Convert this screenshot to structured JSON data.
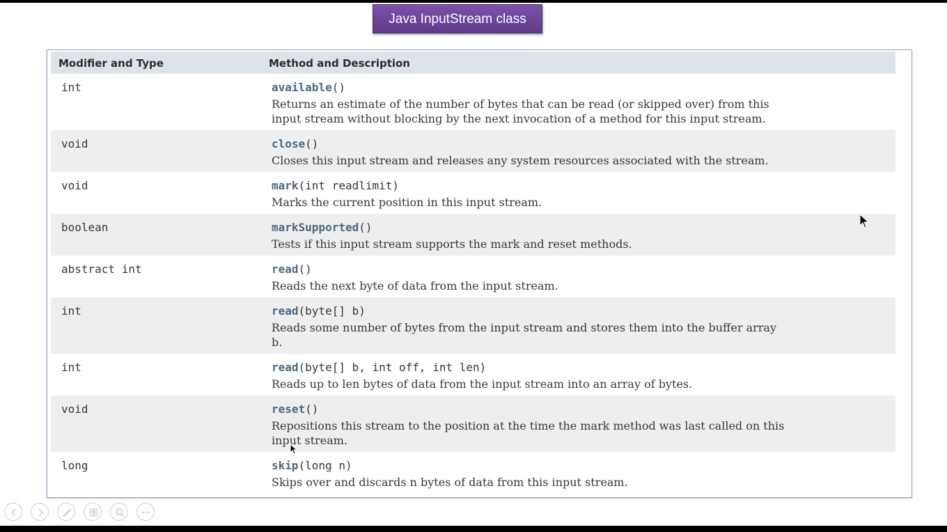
{
  "slide": {
    "title": "Java InputStream class"
  },
  "table": {
    "headers": [
      "Modifier and Type",
      "Method and Description"
    ],
    "rows": [
      {
        "type": "int",
        "name": "available",
        "params": "()",
        "desc": [
          "Returns an estimate of the number of bytes that can be read (or skipped over) from this",
          "input stream without blocking by the next invocation of a method for this input stream."
        ]
      },
      {
        "type": "void",
        "name": "close",
        "params": "()",
        "desc": [
          "Closes this input stream and releases any system resources associated with the stream."
        ]
      },
      {
        "type": "void",
        "name": "mark",
        "params": "(int readlimit)",
        "desc": [
          "Marks the current position in this input stream."
        ]
      },
      {
        "type": "boolean",
        "name": "markSupported",
        "params": "()",
        "desc": [
          "Tests if this input stream supports the mark and reset methods."
        ]
      },
      {
        "type": "abstract int",
        "name": "read",
        "params": "()",
        "desc": [
          "Reads the next byte of data from the input stream."
        ]
      },
      {
        "type": "int",
        "name": "read",
        "params": "(byte[] b)",
        "desc": [
          "Reads some number of bytes from the input stream and stores them into the buffer array",
          "b."
        ]
      },
      {
        "type": "int",
        "name": "read",
        "params": "(byte[] b, int off, int len)",
        "desc": [
          "Reads up to len bytes of data from the input stream into an array of bytes."
        ]
      },
      {
        "type": "void",
        "name": "reset",
        "params": "()",
        "desc": [
          "Repositions this stream to the position at the time the mark method was last called on this",
          "input stream."
        ]
      },
      {
        "type": "long",
        "name": "skip",
        "params": "(long n)",
        "desc": [
          "Skips over and discards n bytes of data from this input stream."
        ]
      }
    ]
  },
  "toolbar": {
    "icons": [
      "previous-icon",
      "next-icon",
      "pen-icon",
      "slides-icon",
      "zoom-icon",
      "more-icon"
    ]
  },
  "colors": {
    "title_bg": "#6a4597",
    "header_bg": "#dee3e9",
    "alt_row_bg": "#eeeeef",
    "method_name": "#4a6782"
  }
}
